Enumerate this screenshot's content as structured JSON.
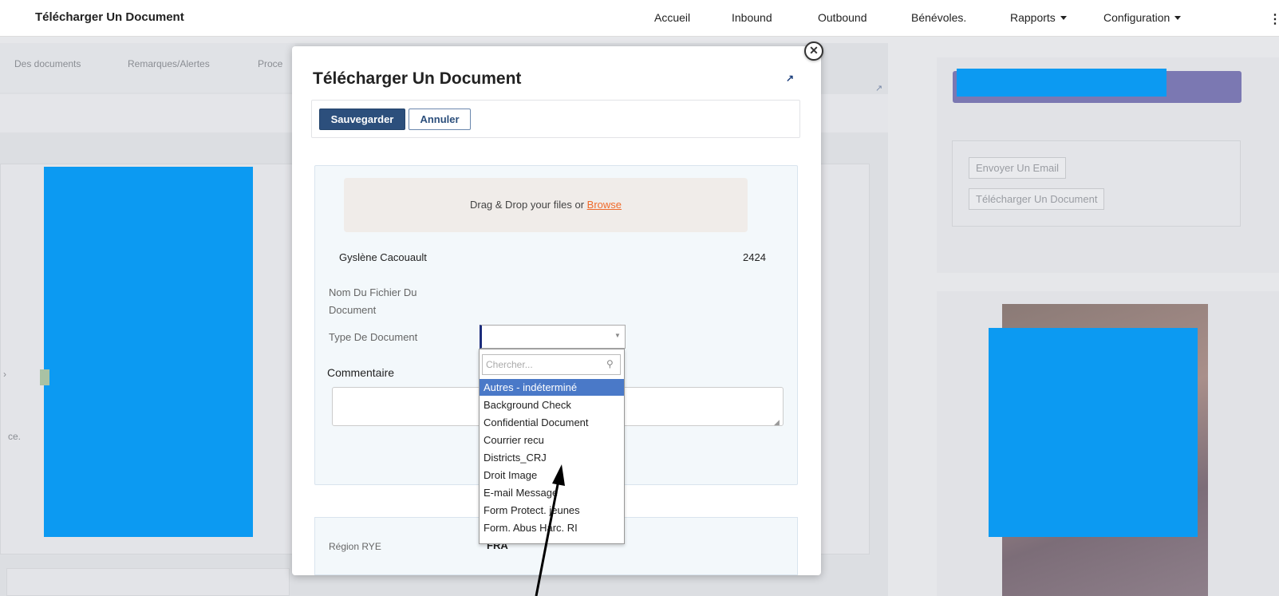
{
  "navbar": {
    "brand": "Télécharger Un Document",
    "items": [
      {
        "label": "Accueil",
        "dropdown": false
      },
      {
        "label": "Inbound",
        "dropdown": false
      },
      {
        "label": "Outbound",
        "dropdown": false
      },
      {
        "label": "Bénévoles.",
        "dropdown": false
      },
      {
        "label": "Rapports",
        "dropdown": true
      },
      {
        "label": "Configuration",
        "dropdown": true
      }
    ],
    "menu_icon": "kebab-icon"
  },
  "background": {
    "tabs": [
      "Des documents",
      "Remarques/Alertes",
      "Proce"
    ],
    "fragment_text": "ce.",
    "right_buttons": [
      "Envoyer Un Email",
      "Télécharger Un Document"
    ],
    "redacted_color": "#0c9af2",
    "header_color": "#7b78b2"
  },
  "modal": {
    "title": "Télécharger Un Document",
    "close_icon": "close-icon",
    "expand_icon": "expand-icon",
    "save_label": "Sauvegarder",
    "cancel_label": "Annuler",
    "dropzone_text": "Drag & Drop your files or ",
    "browse_label": "Browse",
    "person_name": "Gyslène Cacouault",
    "person_id": "2424",
    "filename_label": "Nom Du Fichier Du Document",
    "doctype_label": "Type De Document",
    "doctype_value": "",
    "comment_label": "Commentaire",
    "comment_value": "",
    "region_label": "Région RYE",
    "region_value": "FRA"
  },
  "dropdown": {
    "search_placeholder": "Chercher...",
    "selected_index": 0,
    "options": [
      "Autres - indéterminé",
      "Background Check",
      "Confidential Document",
      "Courrier recu",
      "Districts_CRJ",
      "Droit Image",
      "E-mail Message",
      "Form Protect. jeunes",
      "Form. Abus Harc. RI"
    ]
  },
  "colors": {
    "primary": "#2c4f7c",
    "highlight": "#4a79c8",
    "link": "#f06a2a"
  }
}
